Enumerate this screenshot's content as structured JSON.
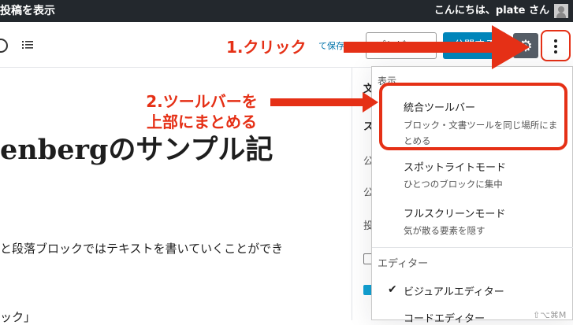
{
  "admin_bar": {
    "left_label": "投稿を表示",
    "greeting": "こんにちは、plate さん"
  },
  "header": {
    "save_draft_fragment": "て保存",
    "preview_label": "プレビュー",
    "publish_label": "公開する"
  },
  "content": {
    "title_fragment": "enbergのサンプル記",
    "paragraph_fragment": "と段落ブロックではテキストを書いていくことができ",
    "bottom_fragment": "ック」"
  },
  "sidebar_behind": {
    "tab_fragment": "文",
    "row1": "ス",
    "row2": "公",
    "row3": "公",
    "row4": "投"
  },
  "menu": {
    "section_view": "表示",
    "items": [
      {
        "label": "統合ツールバー",
        "description": "ブロック・文書ツールを同じ場所にまとめる"
      },
      {
        "label": "スポットライトモード",
        "description": "ひとつのブロックに集中"
      },
      {
        "label": "フルスクリーンモード",
        "description": "気が散る要素を隠す"
      }
    ],
    "section_editor": "エディター",
    "editor_items": [
      {
        "label": "ビジュアルエディター",
        "checked": true
      },
      {
        "label": "コードエディター",
        "shortcut": "⇧⌥⌘M"
      }
    ]
  },
  "annotations": {
    "step1": "1.クリック",
    "step2_line1": "2.ツールバーを",
    "step2_line2": "上部にまとめる",
    "color": "#e53016"
  },
  "colors": {
    "admin_bar": "#23282d",
    "publish": "#0085ba",
    "settings_button": "#555d66"
  }
}
